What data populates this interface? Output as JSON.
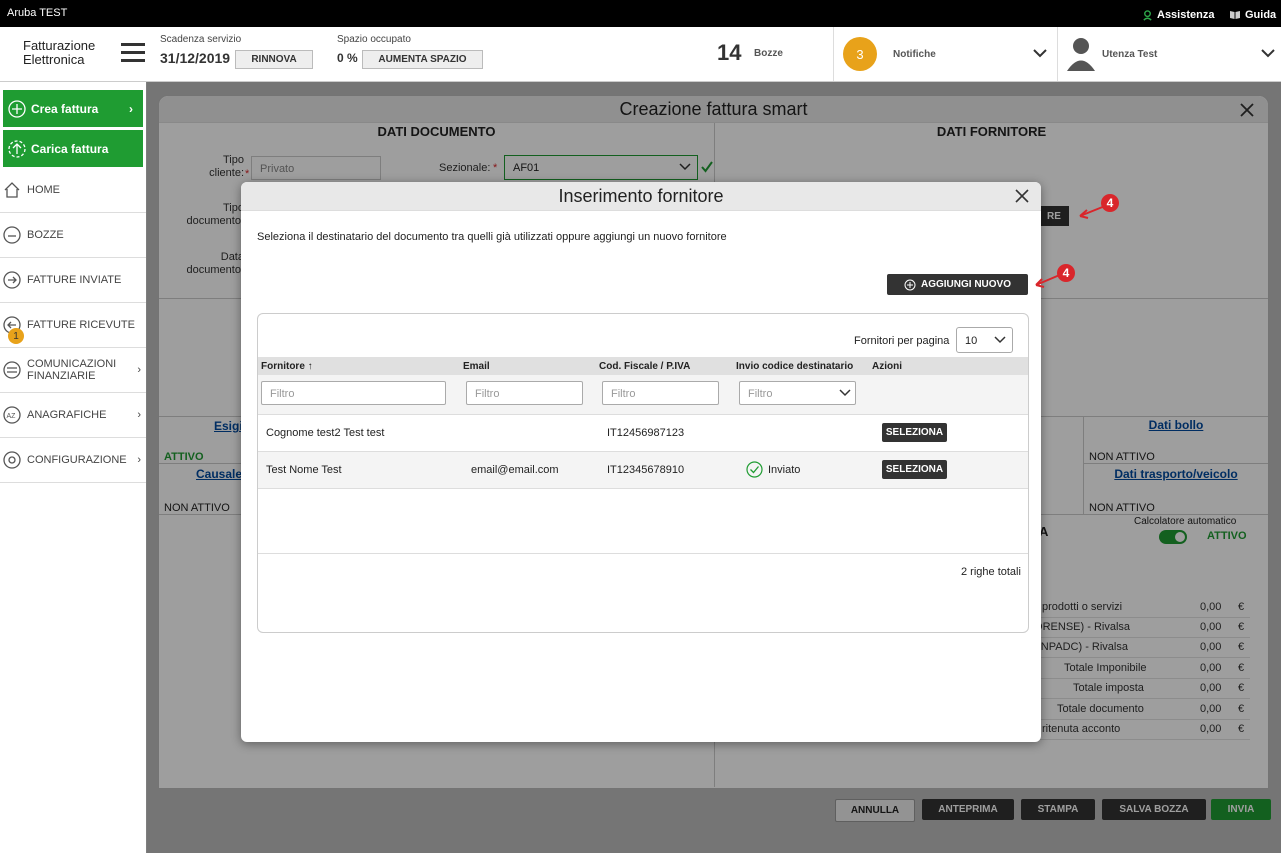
{
  "topbar": {
    "title": "Aruba TEST",
    "assistenza": "Assistenza",
    "guida": "Guida"
  },
  "header": {
    "logo_line1": "Fatturazione",
    "logo_line2": "Elettronica",
    "scadenza_label": "Scadenza servizio",
    "scadenza_value": "31/12/2019",
    "rinnova": "RINNOVA",
    "spazio_label": "Spazio occupato",
    "spazio_value": "0 %",
    "aumenta_spazio": "AUMENTA SPAZIO",
    "bozze_count": "14",
    "bozze_label": "Bozze",
    "notifiche_count": "3",
    "notifiche_label": "Notifiche",
    "utenza": "Utenza Test"
  },
  "sidebar": {
    "crea_fattura": "Crea fattura",
    "carica_fattura": "Carica fattura",
    "items": [
      {
        "label": "HOME"
      },
      {
        "label": "BOZZE"
      },
      {
        "label": "FATTURE INVIATE"
      },
      {
        "label": "FATTURE RICEVUTE",
        "badge": "1"
      },
      {
        "label": "COMUNICAZIONI FINANZIARIE"
      },
      {
        "label": "ANAGRAFICHE"
      },
      {
        "label": "CONFIGURAZIONE"
      }
    ]
  },
  "main": {
    "title": "Creazione fattura smart",
    "dati_documento": "DATI DOCUMENTO",
    "dati_fornitore": "DATI FORNITORE",
    "tipo_cliente_label": "Tipo\ncliente:",
    "tipo_cliente_value": "Privato",
    "sezionale_label": "Sezionale:",
    "sezionale_value": "AF01",
    "tipo_documento_label": "Tipo\ndocumento:",
    "data_documento_label": "Data\ndocumento:",
    "btn_fornitore_partial": "RE",
    "esigibilita_partial": "Esigi",
    "esigibilita_status": "ATTIVO",
    "causale_partial": "Causale",
    "causale_status": "NON ATTIVO",
    "dati_bollo": "Dati bollo",
    "dati_bollo_status": "NON ATTIVO",
    "dati_trasporto": "Dati trasporto/veicolo",
    "dati_trasporto_status": "NON ATTIVO",
    "riepilogo_partial": "A",
    "calcolatore_label": "Calcolatore automatico",
    "calcolatore_status": "ATTIVO",
    "summary": [
      {
        "label": "orto prodotti o servizi",
        "value": "0,00",
        "cur": "€"
      },
      {
        "label": "AFORENSE) - Rivalsa",
        "value": "0,00",
        "cur": "€"
      },
      {
        "label": "a (CNPADC) - Rivalsa",
        "value": "0,00",
        "cur": "€"
      },
      {
        "label": "Totale Imponibile",
        "value": "0,00",
        "cur": "€"
      },
      {
        "label": "Totale imposta",
        "value": "0,00",
        "cur": "€"
      },
      {
        "label": "Totale documento",
        "value": "0,00",
        "cur": "€"
      },
      {
        "label": "orto ritenuta acconto",
        "value": "0,00",
        "cur": "€"
      }
    ],
    "buttons": {
      "annulla": "ANNULLA",
      "anteprima": "ANTEPRIMA",
      "stampa": "STAMPA",
      "salva_bozza": "SALVA BOZZA",
      "invia": "INVIA"
    }
  },
  "modal": {
    "title": "Inserimento fornitore",
    "instruction": "Seleziona il destinatario del documento tra quelli già utilizzati oppure aggiungi un nuovo fornitore",
    "add_new": "AGGIUNGI NUOVO",
    "per_page_label": "Fornitori per pagina",
    "per_page_value": "10",
    "columns": [
      "Fornitore",
      "Email",
      "Cod. Fiscale / P.IVA",
      "Invio codice destinatario",
      "Azioni"
    ],
    "filter_placeholder": "Filtro",
    "rows": [
      {
        "fornitore": "Cognome test2 Test test",
        "email": "",
        "cf": "IT12456987123",
        "invio": "",
        "azione": "SELEZIONA"
      },
      {
        "fornitore": "Test Nome Test",
        "email": "email@email.com",
        "cf": "IT12345678910",
        "invio": "Inviato",
        "azione": "SELEZIONA"
      }
    ],
    "total": "2 righe totali"
  },
  "annotations": {
    "marker1": "4",
    "marker2": "4"
  },
  "colors": {
    "green": "#1f9c32",
    "dark_button": "#333333",
    "link_blue": "#004a9f",
    "orange_badge": "#e8a21a",
    "annotation_red": "#d9262b"
  }
}
